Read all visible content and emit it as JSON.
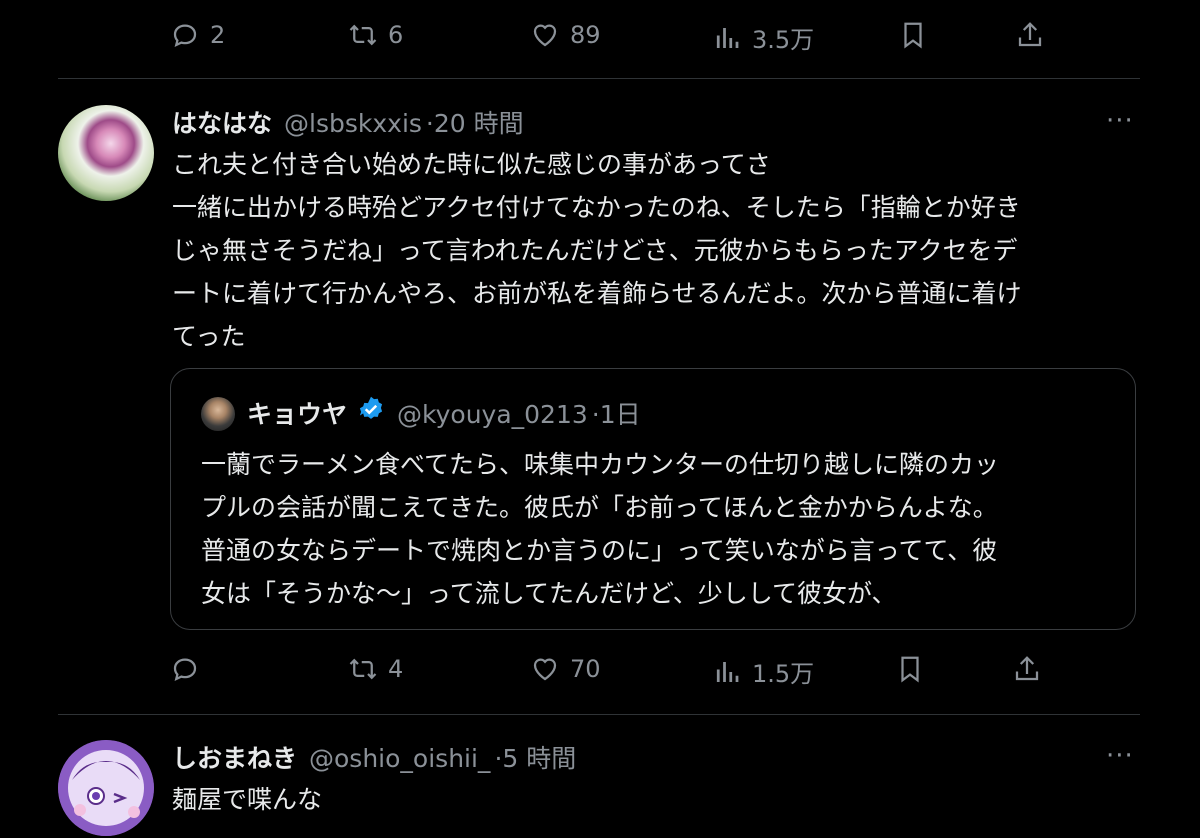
{
  "top_actions": {
    "replies": "2",
    "retweets": "6",
    "likes": "89",
    "views": "3.5万"
  },
  "tweet1": {
    "name": "はなはな",
    "handle": "@lsbskxxis",
    "time": "·20 時間",
    "lines": [
      "これ夫と付き合い始めた時に似た感じの事があってさ",
      "一緒に出かける時殆どアクセ付けてなかったのね、そしたら「指輪とか好き",
      "じゃ無さそうだね」って言われたんだけどさ、元彼からもらったアクセをデ",
      "ートに着けて行かんやろ、お前が私を着飾らせるんだよ。次から普通に着け",
      "てった"
    ],
    "more": "···",
    "quote": {
      "name": "キョウヤ",
      "handle": "@kyouya_0213",
      "time": "·1日",
      "lines": [
        "一蘭でラーメン食べてたら、味集中カウンターの仕切り越しに隣のカッ",
        "プルの会話が聞こえてきた。彼氏が「お前ってほんと金かからんよな。",
        "普通の女ならデートで焼肉とか言うのに」って笑いながら言ってて、彼",
        "女は「そうかな〜」って流してたんだけど、少しして彼女が、"
      ]
    },
    "actions": {
      "replies": "",
      "retweets": "4",
      "likes": "70",
      "views": "1.5万"
    }
  },
  "tweet2": {
    "name": "しおまねき",
    "handle": "@oshio_oishii_",
    "time": "·5 時間",
    "text": "麺屋で喋んな",
    "more": "···"
  },
  "colors": {
    "background": "#000000",
    "text": "#e7e9ea",
    "muted": "#8b9198",
    "verified": "#1d9bf0"
  }
}
